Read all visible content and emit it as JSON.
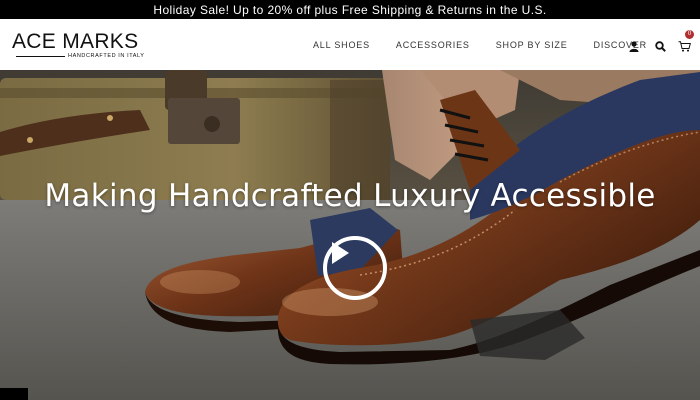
{
  "promo": {
    "text": "Holiday Sale! Up to 20% off plus Free Shipping & Returns in the U.S."
  },
  "header": {
    "logo_text": "ACE MARKS",
    "logo_tagline": "HANDCRAFTED IN ITALY",
    "nav": [
      {
        "label": "ALL SHOES"
      },
      {
        "label": "ACCESSORIES"
      },
      {
        "label": "SHOP BY SIZE"
      },
      {
        "label": "DISCOVER"
      }
    ],
    "icons": [
      "user-icon",
      "search-icon",
      "cart-icon"
    ],
    "cart_count": "0"
  },
  "hero": {
    "title": "Making Handcrafted Luxury Accessible",
    "play_icon": "play-icon"
  },
  "colors": {
    "promo_bg": "#000000",
    "header_bg": "#ffffff",
    "badge": "#b03030"
  }
}
